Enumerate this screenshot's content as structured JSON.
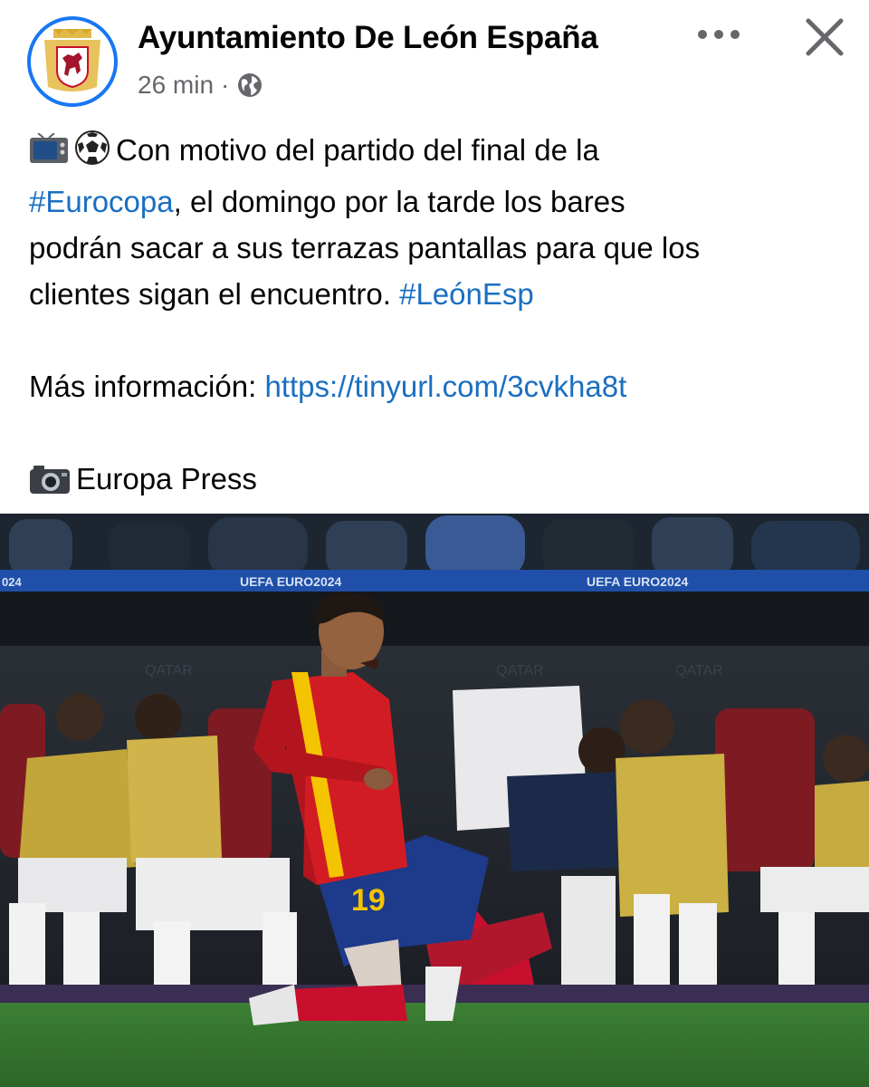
{
  "post": {
    "author": "Ayuntamiento De León España",
    "time": "26 min",
    "separator": "·",
    "lines": {
      "l1": "Con motivo del partido del final de la",
      "hashtag1": "#Eurocopa",
      "l2": ", el domingo por la tarde los bares",
      "l3": "podrán sacar a sus terrazas pantallas para que los",
      "l4": "clientes sigan el encuentro.",
      "hashtag2": "#LeónEsp",
      "info_label": "Más información:",
      "info_link": "https://tinyurl.com/3cvkha8t",
      "credit": "Europa Press"
    }
  },
  "photo": {
    "board_text_1": "UEFA EURO2024",
    "board_text_2": "UEFA EURO2024",
    "board_left": "024",
    "sponsor_1": "QATAR",
    "sponsor_2": "QATAR",
    "sponsor_3": "QATAR",
    "player_number": "19"
  },
  "icons": {
    "privacy": "globe-icon",
    "more": "more-icon",
    "close": "close-icon"
  },
  "colors": {
    "link": "#1a6fc1",
    "avatar_ring": "#1877f2",
    "spain_red": "#c8102e",
    "spain_yellow": "#f5c400"
  }
}
